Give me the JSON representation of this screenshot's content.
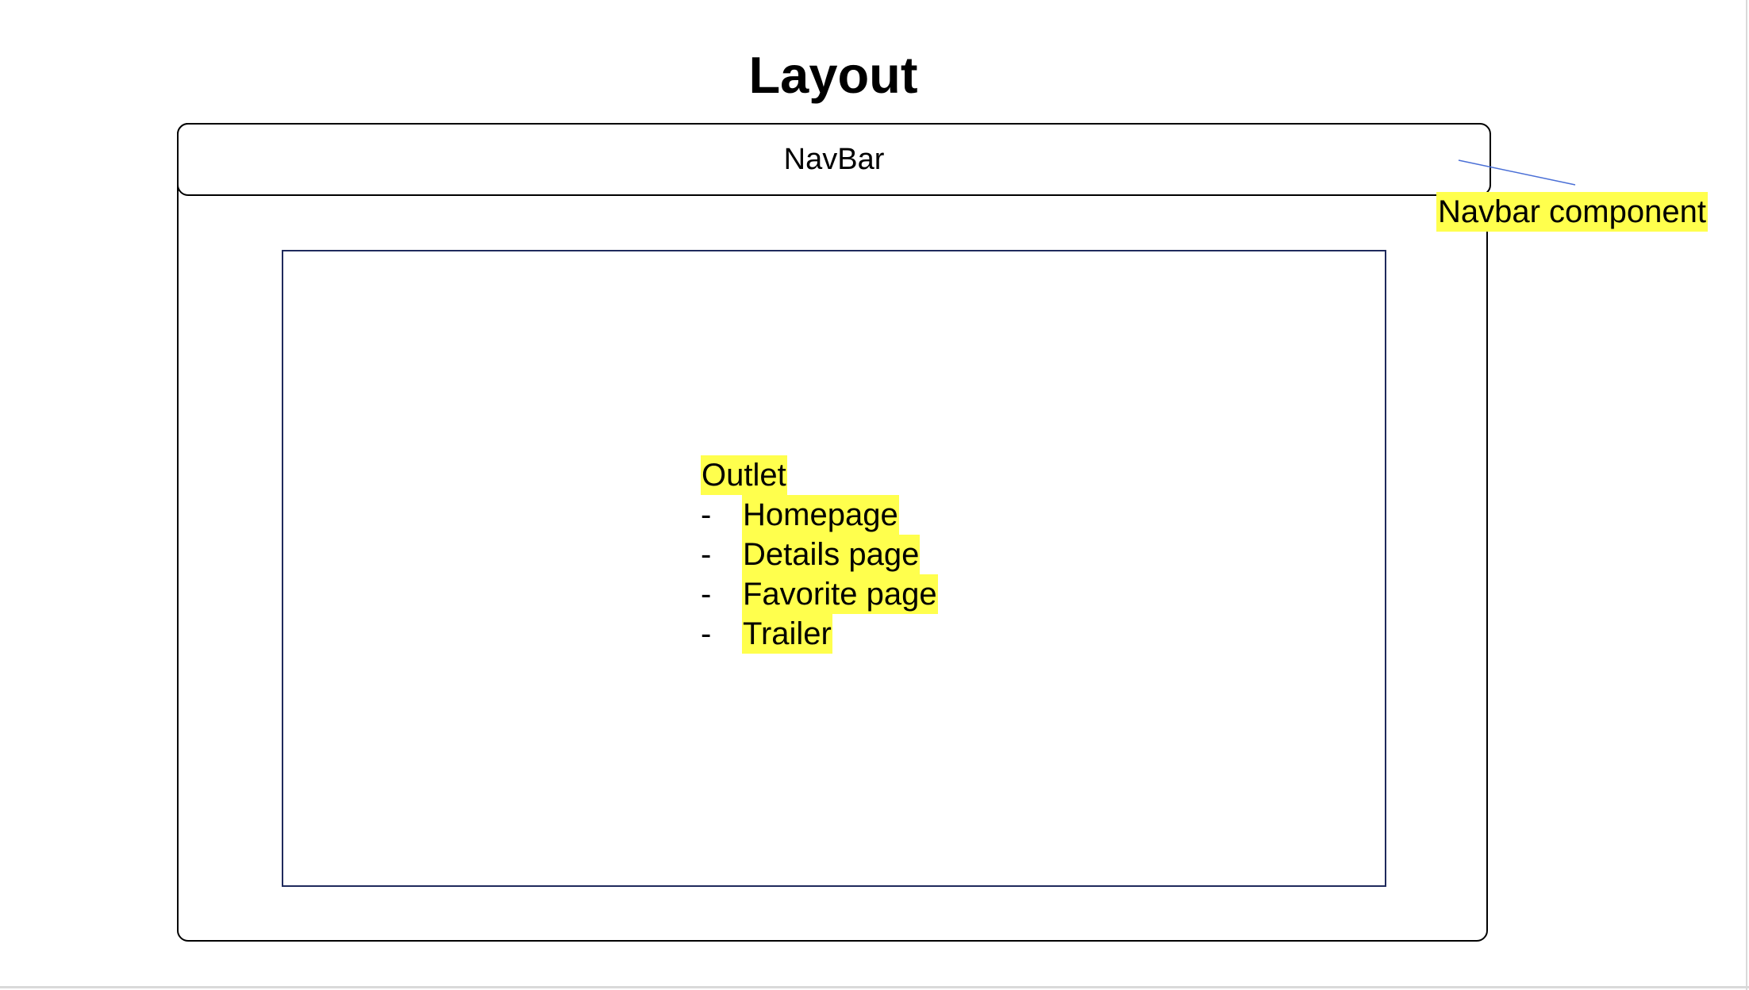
{
  "diagram": {
    "title": "Layout",
    "navbar": {
      "label": "NavBar"
    },
    "callout": {
      "label": "Navbar component"
    },
    "outlet": {
      "heading": "Outlet",
      "bullet": "-",
      "items": [
        "Homepage",
        "Details page",
        "Favorite page",
        "Trailer"
      ]
    }
  },
  "colors": {
    "highlight": "#ffff4d",
    "box_border": "#000000",
    "outlet_border": "#1f2a5c",
    "leader_line": "#4a6fd6"
  }
}
